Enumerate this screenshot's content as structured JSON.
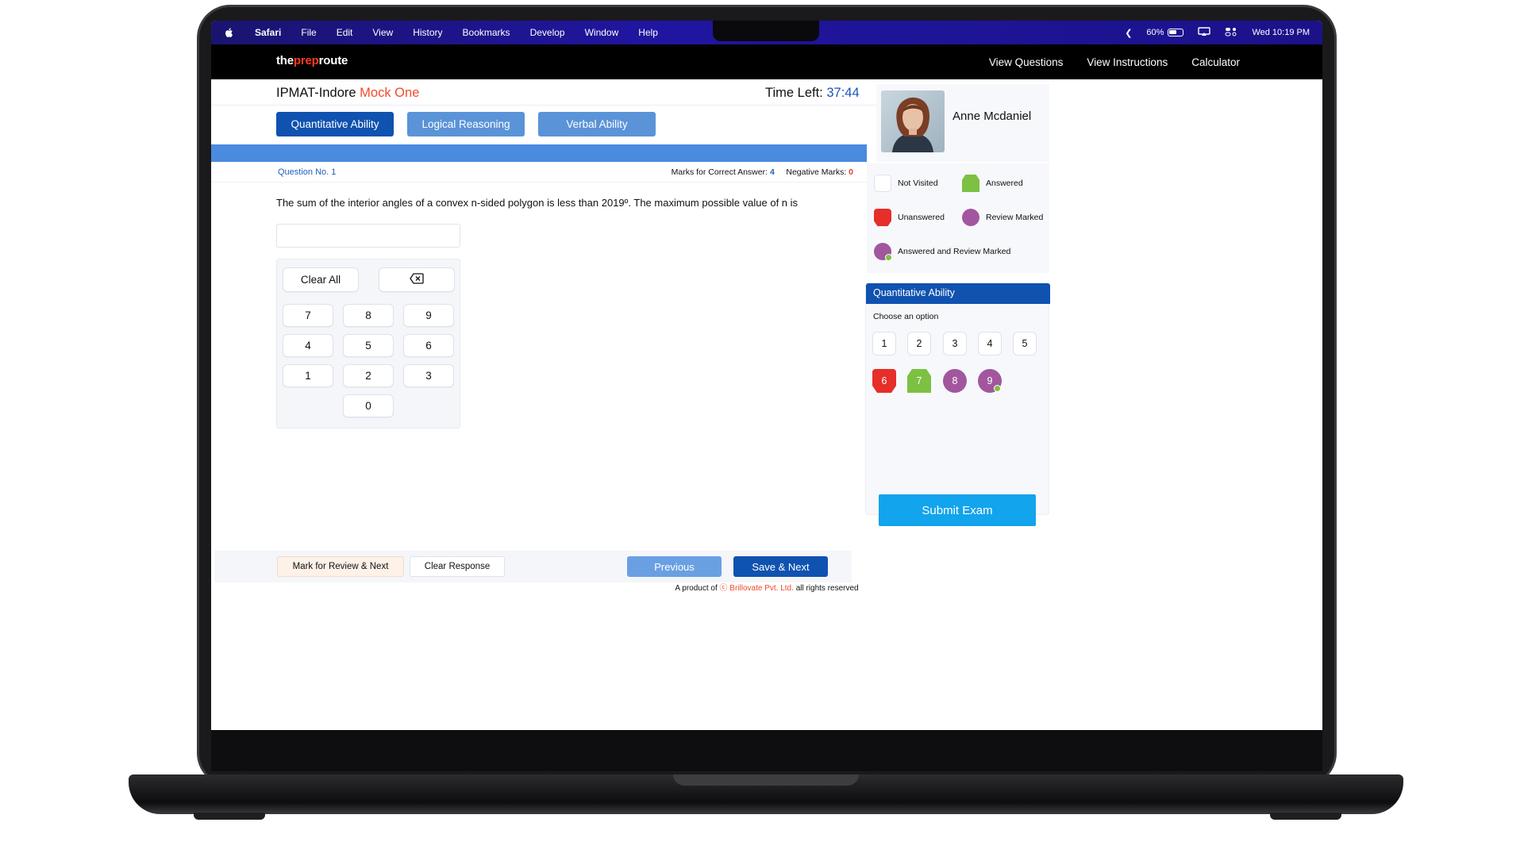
{
  "menubar": {
    "app_name": "Safari",
    "menus": [
      "File",
      "Edit",
      "View",
      "History",
      "Bookmarks",
      "Develop",
      "Window",
      "Help"
    ],
    "battery": "60%",
    "clock": "Wed 10:19 PM"
  },
  "site": {
    "logo_pre": "the",
    "logo_accent": "prep",
    "logo_post": "route",
    "nav": [
      "View Questions",
      "View Instructions",
      "Calculator"
    ]
  },
  "exam": {
    "title_prefix": "IPMAT-Indore",
    "title_accent": "Mock One",
    "timer_label": "Time Left:",
    "timer_value": "37:44"
  },
  "sections": [
    {
      "label": "Quantitative Ability",
      "active": true
    },
    {
      "label": "Logical Reasoning",
      "active": false
    },
    {
      "label": "Verbal Ability",
      "active": false
    }
  ],
  "question": {
    "number_label": "Question No. 1",
    "correct_label": "Marks for Correct Answer:",
    "correct_value": "4",
    "negative_label": "Negative Marks:",
    "negative_value": "0",
    "text": "The sum of the interior angles of a convex n-sided polygon is less than 2019º. The maximum possible value of n is",
    "answer_value": ""
  },
  "keypad": {
    "clear_label": "Clear All",
    "backspace_icon": "backspace-icon",
    "keys": [
      "7",
      "8",
      "9",
      "4",
      "5",
      "6",
      "1",
      "2",
      "3",
      "0"
    ]
  },
  "actions": {
    "review_label": "Mark for Review & Next",
    "clear_label": "Clear Response",
    "previous_label": "Previous",
    "save_label": "Save & Next"
  },
  "footer": {
    "prefix": "A product of",
    "company": "ⓒ Brillovate Pvt. Ltd.",
    "suffix": "all rights reserved"
  },
  "candidate": {
    "name": "Anne Mcdaniel"
  },
  "legend": {
    "not_visited": "Not Visited",
    "answered": "Answered",
    "unanswered": "Unanswered",
    "review_marked": "Review Marked",
    "answered_review": "Answered and Review Marked"
  },
  "palette": {
    "section_title": "Quantitative Ability",
    "choose_label": "Choose an option",
    "questions": [
      {
        "n": "1",
        "status": "not-visited"
      },
      {
        "n": "2",
        "status": "not-visited"
      },
      {
        "n": "3",
        "status": "not-visited"
      },
      {
        "n": "4",
        "status": "not-visited"
      },
      {
        "n": "5",
        "status": "not-visited"
      },
      {
        "n": "6",
        "status": "unanswered"
      },
      {
        "n": "7",
        "status": "answered"
      },
      {
        "n": "8",
        "status": "review-marked"
      },
      {
        "n": "9",
        "status": "answered-review-marked"
      }
    ]
  },
  "submit_label": "Submit Exam",
  "colors": {
    "primary": "#0f52b0",
    "accent_red": "#f04a2a",
    "answered_green": "#7cc142",
    "unanswered_red": "#e62e2a",
    "review_purple": "#a2569e",
    "submit_blue": "#12a4ec"
  }
}
